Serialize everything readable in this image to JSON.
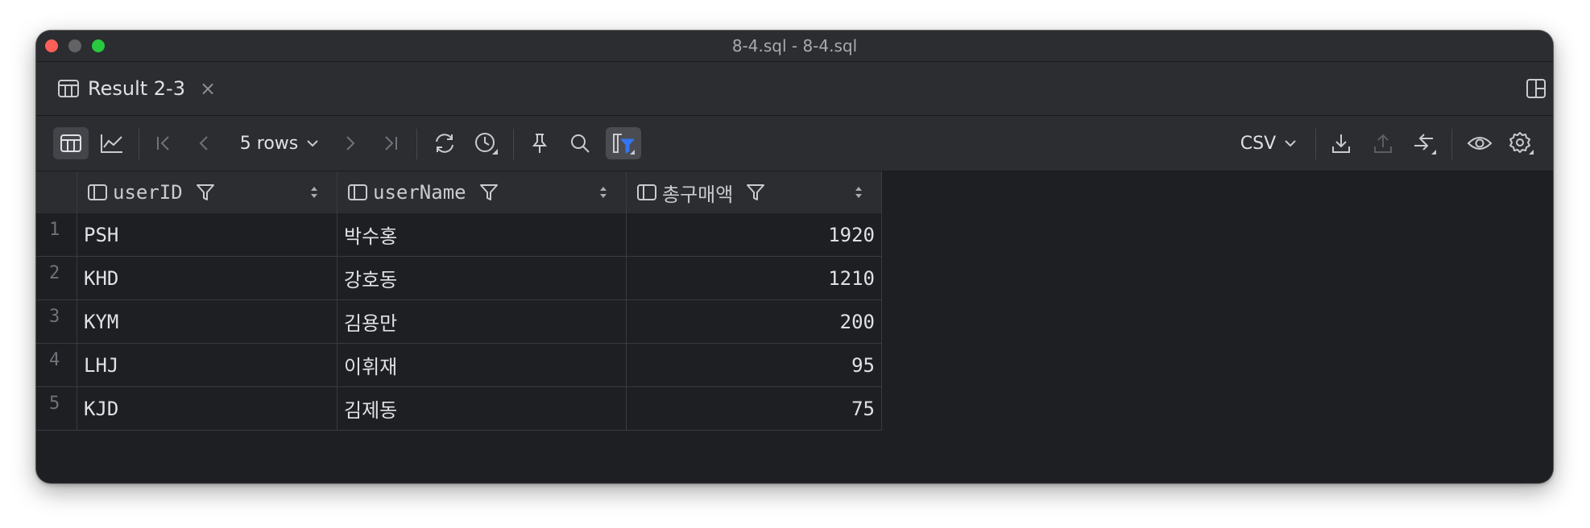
{
  "window": {
    "title": "8-4.sql - 8-4.sql"
  },
  "tab": {
    "label": "Result 2-3",
    "close": "×"
  },
  "toolbar": {
    "rows_label": "5 rows",
    "export_format": "CSV"
  },
  "table": {
    "columns": [
      {
        "name": "userID"
      },
      {
        "name": "userName"
      },
      {
        "name": "총구매액"
      }
    ],
    "rows": [
      {
        "num": "1",
        "userID": "PSH",
        "userName": "박수홍",
        "total": "1920"
      },
      {
        "num": "2",
        "userID": "KHD",
        "userName": "강호동",
        "total": "1210"
      },
      {
        "num": "3",
        "userID": "KYM",
        "userName": "김용만",
        "total": "200"
      },
      {
        "num": "4",
        "userID": "LHJ",
        "userName": "이휘재",
        "total": "95"
      },
      {
        "num": "5",
        "userID": "KJD",
        "userName": "김제동",
        "total": "75"
      }
    ]
  },
  "colors": {
    "accent": "#3574f0",
    "background": "#1e1f22",
    "panel": "#2b2d30"
  }
}
